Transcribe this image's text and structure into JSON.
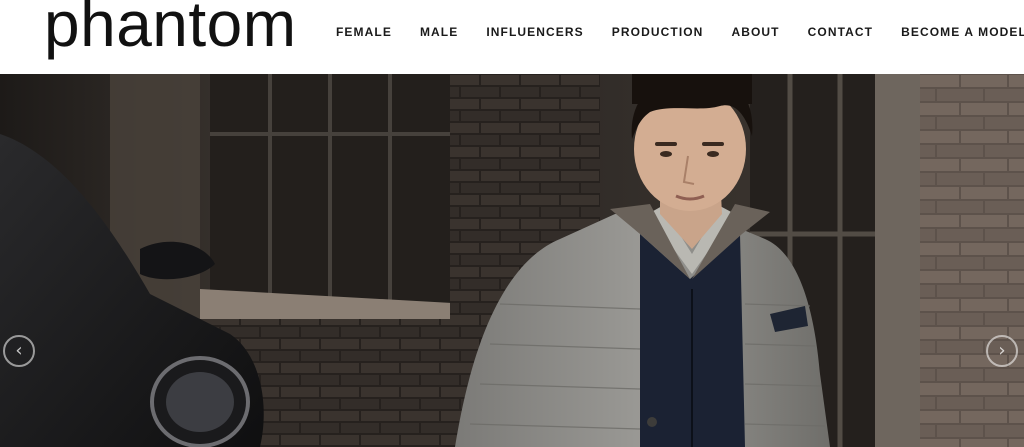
{
  "brand": {
    "logo_text": "phantom"
  },
  "nav": {
    "items": [
      {
        "label": "FEMALE"
      },
      {
        "label": "MALE"
      },
      {
        "label": "INFLUENCERS"
      },
      {
        "label": "PRODUCTION"
      },
      {
        "label": "ABOUT"
      },
      {
        "label": "CONTACT"
      },
      {
        "label": "BECOME A MODEL"
      }
    ]
  },
  "hero": {
    "prev_icon": "chevron-left-icon",
    "next_icon": "chevron-right-icon",
    "prev_glyph": "‹",
    "next_glyph": "›",
    "image_subject": "male-model-grey-quilted-jacket",
    "colors": {
      "background": "#2b2724",
      "brick": "#6b5f57",
      "jacket": "#8a8985"
    }
  }
}
